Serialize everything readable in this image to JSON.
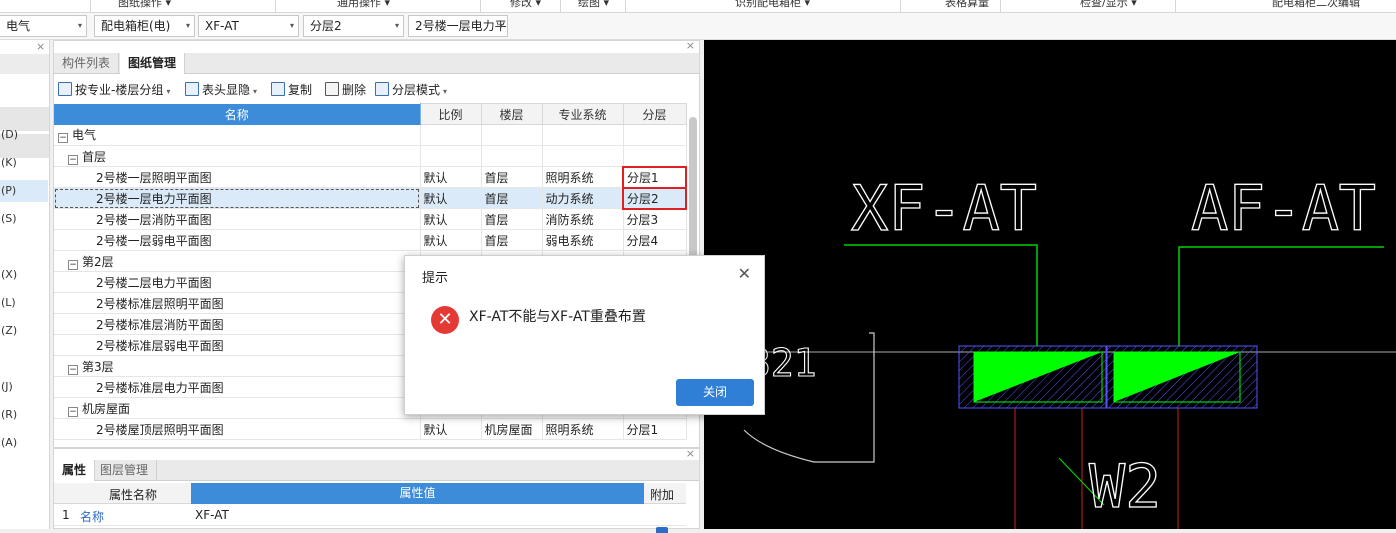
{
  "ribbon": {
    "groups": [
      "图纸操作 ▾",
      "通用操作 ▾",
      "修改 ▾",
      "绘图 ▾",
      "识别配电箱柜 ▾",
      "表格算量",
      "检查/显示 ▾",
      "配电箱柜二次编辑"
    ]
  },
  "filters": {
    "specialty": "电气",
    "type": "配电箱柜(电)",
    "component": "XF-AT",
    "layer": "分层2",
    "drawing": "2号楼一层电力平"
  },
  "left_strip": {
    "items": [
      "(D)",
      "(K)",
      "(P)",
      "(S)",
      "(X)",
      "(L)",
      "(Z)",
      "(J)",
      "(R)",
      "(A)"
    ]
  },
  "panel": {
    "tabs": [
      "构件列表",
      "图纸管理"
    ],
    "toolbar": {
      "group_by": "按专业-楼层分组",
      "header_show": "表头显隐",
      "copy": "复制",
      "delete": "删除",
      "layer_mode": "分层模式"
    },
    "columns": [
      "名称",
      "比例",
      "楼层",
      "专业系统",
      "分层"
    ],
    "rows": [
      {
        "name": "电气",
        "level": 0,
        "group": true,
        "scale": "",
        "floor": "",
        "system": "",
        "layer": ""
      },
      {
        "name": "首层",
        "level": 1,
        "group": true,
        "scale": "",
        "floor": "",
        "system": "",
        "layer": ""
      },
      {
        "name": "2号楼一层照明平面图",
        "level": 2,
        "group": false,
        "scale": "默认",
        "floor": "首层",
        "system": "照明系统",
        "layer": "分层1"
      },
      {
        "name": "2号楼一层电力平面图",
        "level": 2,
        "group": false,
        "scale": "默认",
        "floor": "首层",
        "system": "动力系统",
        "layer": "分层2"
      },
      {
        "name": "2号楼一层消防平面图",
        "level": 2,
        "group": false,
        "scale": "默认",
        "floor": "首层",
        "system": "消防系统",
        "layer": "分层3"
      },
      {
        "name": "2号楼一层弱电平面图",
        "level": 2,
        "group": false,
        "scale": "默认",
        "floor": "首层",
        "system": "弱电系统",
        "layer": "分层4"
      },
      {
        "name": "第2层",
        "level": 1,
        "group": true,
        "scale": "",
        "floor": "",
        "system": "",
        "layer": ""
      },
      {
        "name": "2号楼二层电力平面图",
        "level": 2,
        "group": false,
        "scale": "",
        "floor": "",
        "system": "",
        "layer": ""
      },
      {
        "name": "2号楼标准层照明平面图",
        "level": 2,
        "group": false,
        "scale": "",
        "floor": "",
        "system": "",
        "layer": ""
      },
      {
        "name": "2号楼标准层消防平面图",
        "level": 2,
        "group": false,
        "scale": "",
        "floor": "",
        "system": "",
        "layer": ""
      },
      {
        "name": "2号楼标准层弱电平面图",
        "level": 2,
        "group": false,
        "scale": "",
        "floor": "",
        "system": "",
        "layer": ""
      },
      {
        "name": "第3层",
        "level": 1,
        "group": true,
        "scale": "",
        "floor": "",
        "system": "",
        "layer": ""
      },
      {
        "name": "2号楼标准层电力平面图",
        "level": 2,
        "group": false,
        "scale": "",
        "floor": "",
        "system": "",
        "layer": ""
      },
      {
        "name": "机房屋面",
        "level": 1,
        "group": true,
        "scale": "",
        "floor": "",
        "system": "",
        "layer": ""
      },
      {
        "name": "2号楼屋顶层照明平面图",
        "level": 2,
        "group": false,
        "scale": "默认",
        "floor": "机房屋面",
        "system": "照明系统",
        "layer": "分层1"
      }
    ],
    "selected_row": 3,
    "highlighted_layers": [
      2,
      3
    ]
  },
  "props": {
    "tabs": [
      "属性",
      "图层管理"
    ],
    "columns": [
      "属性名称",
      "属性值",
      "附加"
    ],
    "rows": [
      {
        "index": "1",
        "name": "名称",
        "value": "XF-AT"
      }
    ]
  },
  "cad": {
    "labels": {
      "box1": "XF-AT",
      "box2": "AF-AT",
      "circuit": "W2",
      "partial": "321"
    }
  },
  "dialog": {
    "title": "提示",
    "message": "XF-AT不能与XF-AT重叠布置",
    "close_button": "关闭"
  },
  "colors": {
    "accent": "#3d8cd9",
    "error": "#e53935",
    "cad_bg": "#000000",
    "cad_fill": "#00ff00",
    "hatch": "#5555ff"
  }
}
